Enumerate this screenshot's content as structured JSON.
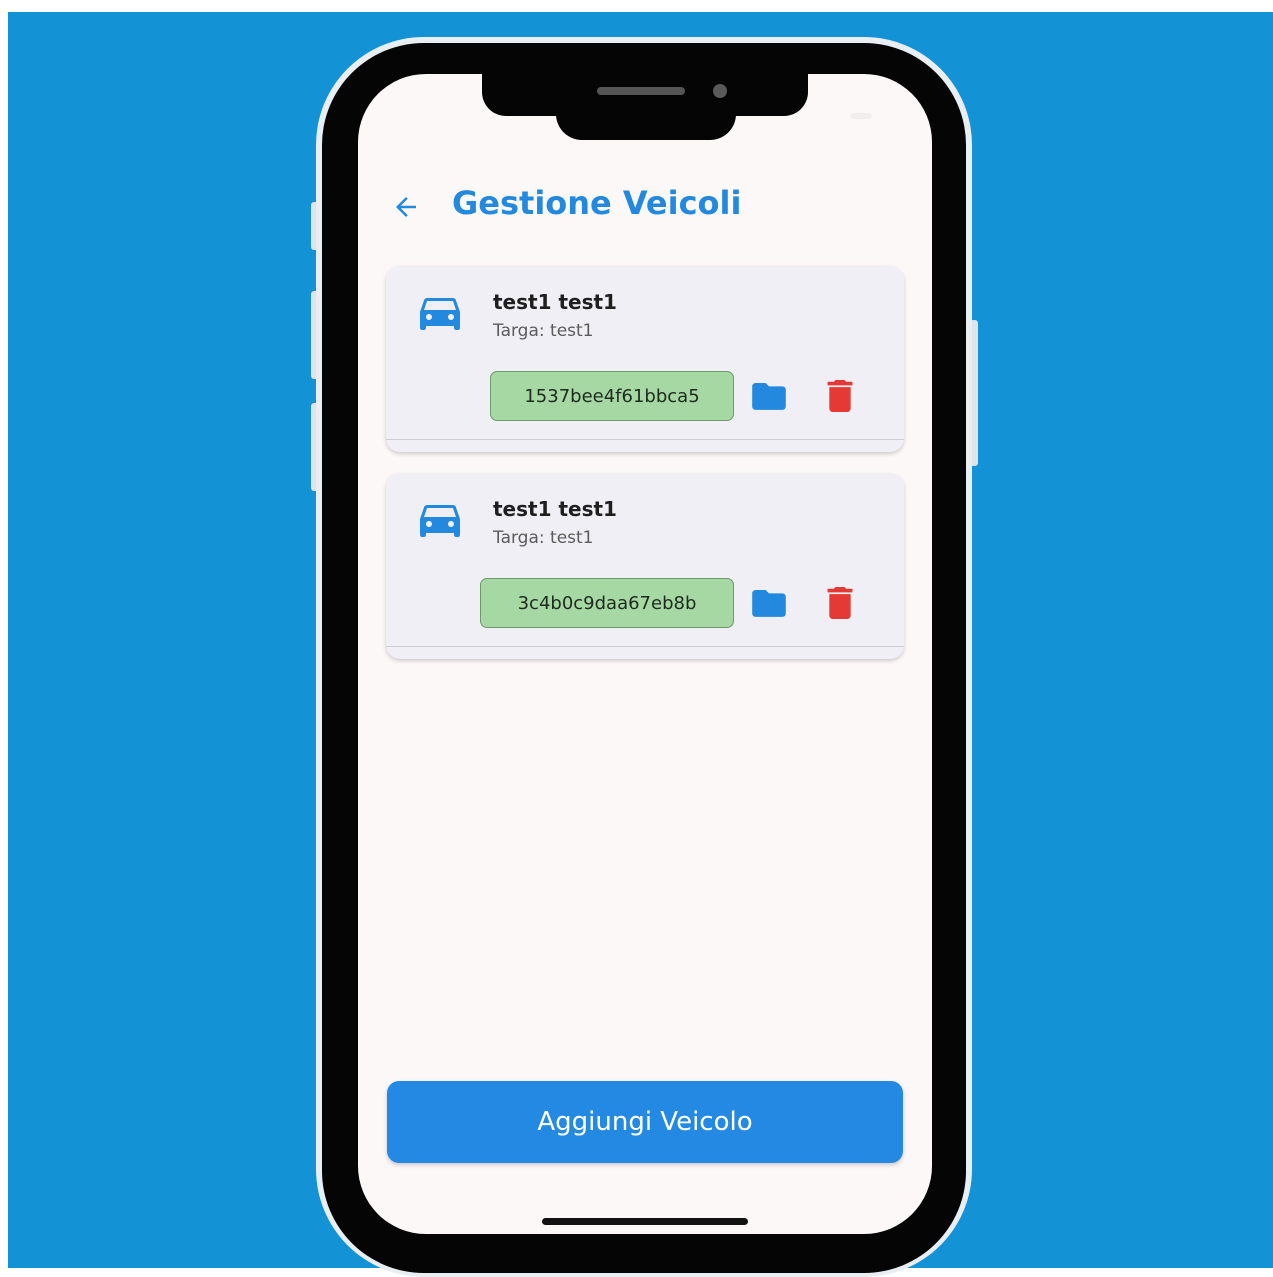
{
  "header": {
    "title": "Gestione Veicoli",
    "back_icon": "arrow-left-icon"
  },
  "vehicles": [
    {
      "name": "test1 test1",
      "plate_label": "Targa:",
      "plate_value": "test1",
      "code": "1537bee4f61bbca5"
    },
    {
      "name": "test1 test1",
      "plate_label": "Targa:",
      "plate_value": "test1",
      "code": "3c4b0c9daa67eb8b"
    }
  ],
  "actions": {
    "add_label": "Aggiungi Veicolo"
  },
  "icons": {
    "vehicle": "car-icon",
    "documents": "folder-icon",
    "delete": "trash-icon"
  },
  "colors": {
    "accent": "#2389e3",
    "code_chip": "#a5d8a3",
    "delete": "#e53935",
    "background": "#1393d6"
  }
}
